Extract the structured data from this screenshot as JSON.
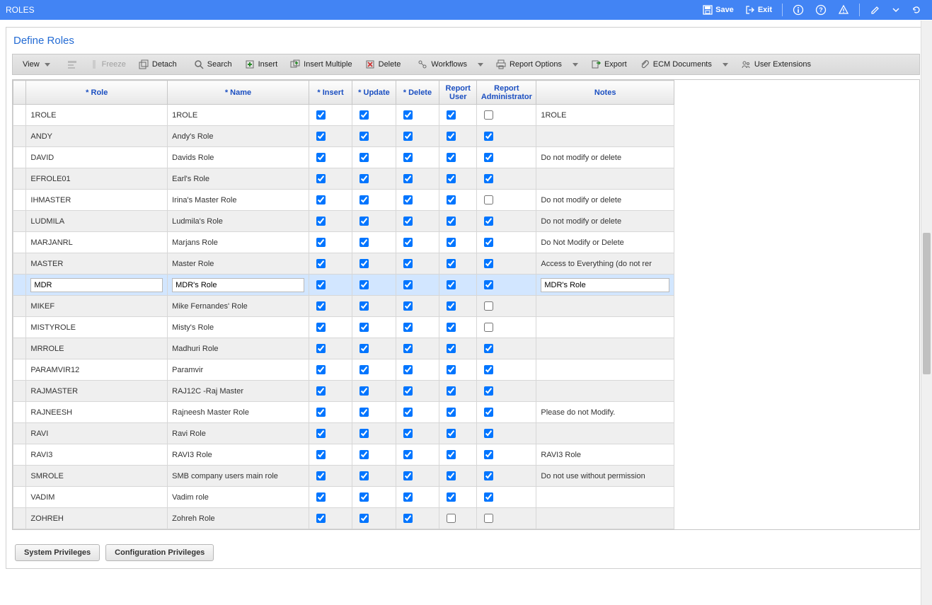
{
  "header": {
    "title": "ROLES",
    "save": "Save",
    "exit": "Exit"
  },
  "panel": {
    "title": "Define Roles"
  },
  "toolbar": {
    "view": "View",
    "freeze": "Freeze",
    "detach": "Detach",
    "search": "Search",
    "insert": "Insert",
    "insert_multiple": "Insert Multiple",
    "delete": "Delete",
    "workflows": "Workflows",
    "report_options": "Report Options",
    "export": "Export",
    "ecm": "ECM Documents",
    "user_ext": "User Extensions"
  },
  "columns": {
    "role": "* Role",
    "name": "* Name",
    "insert": "* Insert",
    "update": "* Update",
    "delete": "* Delete",
    "report_user": "Report User",
    "report_admin": "Report Administrator",
    "notes": "Notes"
  },
  "selected_index": 8,
  "rows": [
    {
      "role": "1ROLE",
      "name": "1ROLE",
      "insert": true,
      "update": true,
      "delete": true,
      "report_user": true,
      "report_admin": false,
      "notes": "1ROLE"
    },
    {
      "role": "ANDY",
      "name": "Andy's Role",
      "insert": true,
      "update": true,
      "delete": true,
      "report_user": true,
      "report_admin": true,
      "notes": ""
    },
    {
      "role": "DAVID",
      "name": "Davids Role",
      "insert": true,
      "update": true,
      "delete": true,
      "report_user": true,
      "report_admin": true,
      "notes": "Do not modify or delete"
    },
    {
      "role": "EFROLE01",
      "name": "Earl's Role",
      "insert": true,
      "update": true,
      "delete": true,
      "report_user": true,
      "report_admin": true,
      "notes": ""
    },
    {
      "role": "IHMASTER",
      "name": "Irina's Master Role",
      "insert": true,
      "update": true,
      "delete": true,
      "report_user": true,
      "report_admin": false,
      "notes": "Do not modify or delete"
    },
    {
      "role": "LUDMILA",
      "name": "Ludmila's Role",
      "insert": true,
      "update": true,
      "delete": true,
      "report_user": true,
      "report_admin": true,
      "notes": "Do not modify or delete"
    },
    {
      "role": "MARJANRL",
      "name": "Marjans Role",
      "insert": true,
      "update": true,
      "delete": true,
      "report_user": true,
      "report_admin": true,
      "notes": "Do Not Modify or Delete"
    },
    {
      "role": "MASTER",
      "name": "Master Role",
      "insert": true,
      "update": true,
      "delete": true,
      "report_user": true,
      "report_admin": true,
      "notes": "Access to Everything (do not rer"
    },
    {
      "role": "MDR",
      "name": "MDR's Role",
      "insert": true,
      "update": true,
      "delete": true,
      "report_user": true,
      "report_admin": true,
      "notes": "MDR's Role"
    },
    {
      "role": "MIKEF",
      "name": "Mike Fernandes' Role",
      "insert": true,
      "update": true,
      "delete": true,
      "report_user": true,
      "report_admin": false,
      "notes": ""
    },
    {
      "role": "MISTYROLE",
      "name": "Misty's Role",
      "insert": true,
      "update": true,
      "delete": true,
      "report_user": true,
      "report_admin": false,
      "notes": ""
    },
    {
      "role": "MRROLE",
      "name": "Madhuri Role",
      "insert": true,
      "update": true,
      "delete": true,
      "report_user": true,
      "report_admin": true,
      "notes": ""
    },
    {
      "role": "PARAMVIR12",
      "name": "Paramvir",
      "insert": true,
      "update": true,
      "delete": true,
      "report_user": true,
      "report_admin": true,
      "notes": ""
    },
    {
      "role": "RAJMASTER",
      "name": "RAJ12C -Raj Master",
      "insert": true,
      "update": true,
      "delete": true,
      "report_user": true,
      "report_admin": true,
      "notes": ""
    },
    {
      "role": "RAJNEESH",
      "name": "Rajneesh Master Role",
      "insert": true,
      "update": true,
      "delete": true,
      "report_user": true,
      "report_admin": true,
      "notes": "Please do not Modify."
    },
    {
      "role": "RAVI",
      "name": "Ravi Role",
      "insert": true,
      "update": true,
      "delete": true,
      "report_user": true,
      "report_admin": true,
      "notes": ""
    },
    {
      "role": "RAVI3",
      "name": "RAVI3 Role",
      "insert": true,
      "update": true,
      "delete": true,
      "report_user": true,
      "report_admin": true,
      "notes": "RAVI3 Role"
    },
    {
      "role": "SMROLE",
      "name": "SMB company users main role",
      "insert": true,
      "update": true,
      "delete": true,
      "report_user": true,
      "report_admin": true,
      "notes": "Do not use without permission"
    },
    {
      "role": "VADIM",
      "name": "Vadim role",
      "insert": true,
      "update": true,
      "delete": true,
      "report_user": true,
      "report_admin": true,
      "notes": ""
    },
    {
      "role": "ZOHREH",
      "name": "Zohreh Role",
      "insert": true,
      "update": true,
      "delete": true,
      "report_user": false,
      "report_admin": false,
      "notes": ""
    }
  ],
  "footer": {
    "sys_priv": "System Privileges",
    "config_priv": "Configuration Privileges"
  }
}
